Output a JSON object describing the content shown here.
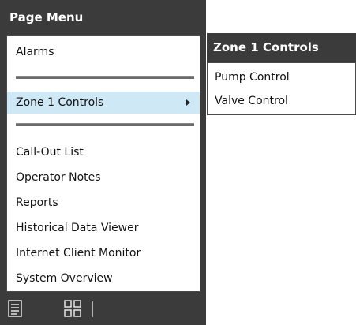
{
  "page_menu": {
    "title": "Page Menu",
    "items": [
      {
        "label": "Alarms"
      },
      {
        "label": "Zone 1 Controls"
      },
      {
        "label": "Call-Out List"
      },
      {
        "label": "Operator Notes"
      },
      {
        "label": "Reports"
      },
      {
        "label": "Historical Data Viewer"
      },
      {
        "label": "Internet Client Monitor"
      },
      {
        "label": "System Overview"
      }
    ]
  },
  "submenu": {
    "title": "Zone 1 Controls",
    "items": [
      {
        "label": "Pump Control"
      },
      {
        "label": "Valve Control"
      }
    ]
  },
  "toolbar": {
    "icons": [
      "list-view-icon",
      "grid-view-icon"
    ]
  },
  "colors": {
    "menu_background": "#3b3b3b",
    "selected_highlight": "#cfe8f6",
    "header_text": "#ffffff"
  }
}
